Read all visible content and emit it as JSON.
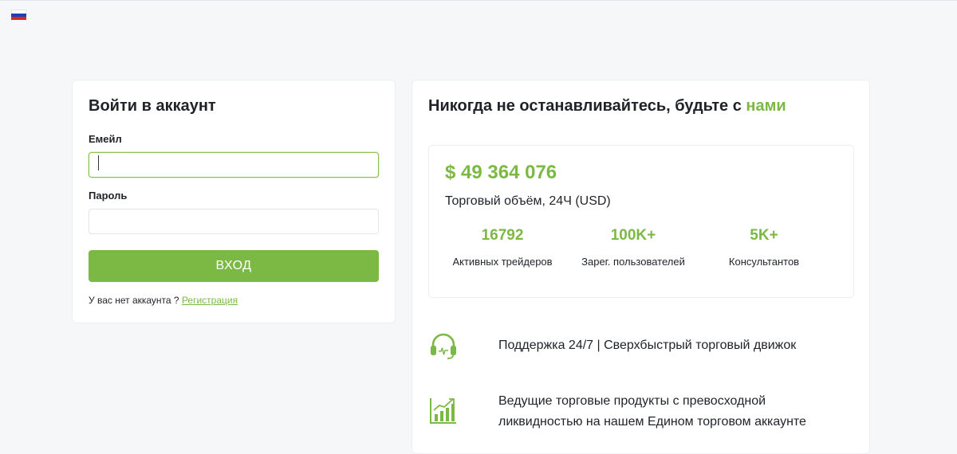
{
  "language": {
    "flag_colors": [
      "#ffffff",
      "#1c3fbf",
      "#d52b1e"
    ],
    "icon": "russian-flag-icon"
  },
  "login": {
    "title": "Войти в аккаунт",
    "email_label": "Емейл",
    "email_value": "",
    "password_label": "Пароль",
    "password_value": "",
    "submit_label": "ВХОД",
    "no_account_text": "У вас нет аккаунта ?",
    "register_link": "Регистрация"
  },
  "info": {
    "title_prefix": "Никогда не останавливайтесь, будьте с",
    "title_accent": "нами",
    "volume_value": "$ 49 364 076",
    "volume_label": "Торговый объём, 24Ч (USD)",
    "stats": [
      {
        "value": "16792",
        "label": "Активных трейдеров"
      },
      {
        "value": "100K+",
        "label": "Зарег. пользователей"
      },
      {
        "value": "5K+",
        "label": "Консультантов"
      }
    ],
    "features": [
      {
        "icon": "headset-icon",
        "lines": [
          "Поддержка 24/7 | Сверхбыстрый торговый движок"
        ]
      },
      {
        "icon": "growth-chart-icon",
        "lines": [
          "Ведущие торговые продукты с превосходной",
          "ликвидностью на нашем Едином торговом аккаунте"
        ]
      }
    ]
  },
  "colors": {
    "accent": "#7cb944",
    "text": "#1f2328",
    "background": "#f6f7f9",
    "border": "#eceef1"
  }
}
